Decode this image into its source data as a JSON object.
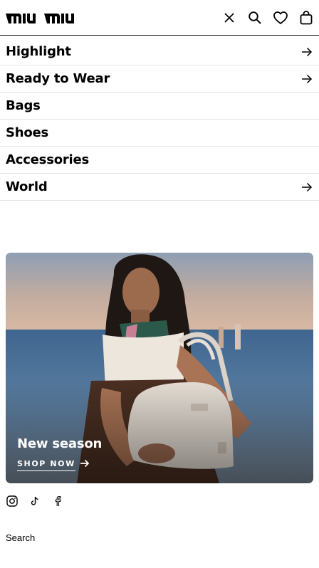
{
  "header": {
    "brand": "miu miu",
    "icons": [
      "close-icon",
      "search-icon",
      "heart-icon",
      "bag-icon"
    ]
  },
  "menu": {
    "items": [
      {
        "label": "Highlight",
        "has_arrow": true
      },
      {
        "label": "Ready to Wear",
        "has_arrow": true
      },
      {
        "label": "Bags",
        "has_arrow": false
      },
      {
        "label": "Shoes",
        "has_arrow": false
      },
      {
        "label": "Accessories",
        "has_arrow": false
      },
      {
        "label": "World",
        "has_arrow": true
      }
    ]
  },
  "banner": {
    "title": "New season",
    "cta": "SHOP NOW"
  },
  "social": {
    "icons": [
      "instagram-icon",
      "tiktok-icon",
      "facebook-icon"
    ]
  },
  "footer": {
    "search_label": "Search"
  },
  "colors": {
    "text": "#000000",
    "divider": "#e4e4e4",
    "banner_text": "#ffffff"
  }
}
